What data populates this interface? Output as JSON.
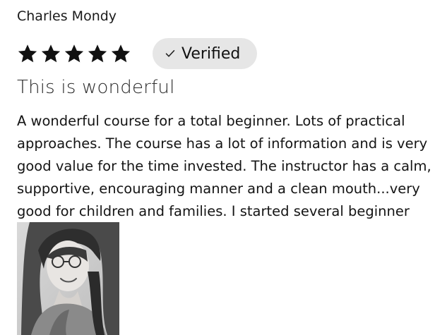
{
  "review": {
    "author": "Charles Mondy",
    "rating": 5,
    "rating_max": 5,
    "badge": {
      "label": "Verified",
      "icon": "checkmark-icon"
    },
    "title": "This is wonderful",
    "body": "A wonderful course for a total beginner. Lots of practical approaches. The course has a lot of information and is very good value for the time invested. The instructor has a calm, supportive, encouraging manner and a clean mouth...very good for children and families. I started several beginner",
    "photo": {
      "icon": "reviewer-photo"
    }
  },
  "colors": {
    "star": "#111111",
    "badge_bg": "#e6e6e6",
    "text": "#141414"
  }
}
